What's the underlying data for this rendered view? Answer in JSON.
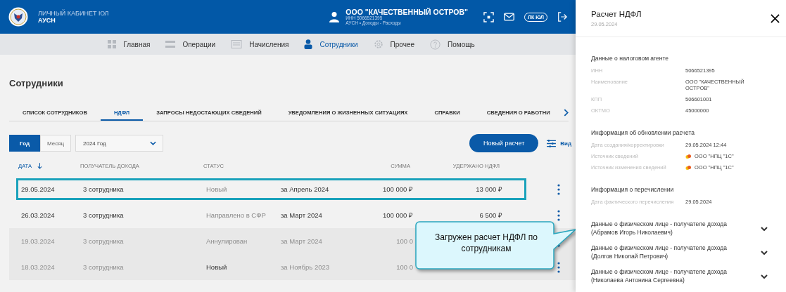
{
  "header": {
    "title": "ЛИЧНЫЙ КАБИНЕТ ЮЛ",
    "subtitle": "АУСН",
    "org": {
      "name": "ООО \"КАЧЕСТВЕННЫЙ ОСТРОВ\"",
      "inn": "ИНН 5066521395",
      "regime": "АУСН • Доходы - Расходы"
    },
    "lk_badge": "ЛК ЮЛ"
  },
  "nav": [
    {
      "label": "Главная",
      "selected": false
    },
    {
      "label": "Операции",
      "selected": false
    },
    {
      "label": "Начисления",
      "selected": false
    },
    {
      "label": "Сотрудники",
      "selected": true
    },
    {
      "label": "Прочее",
      "selected": false
    },
    {
      "label": "Помощь",
      "selected": false
    }
  ],
  "page_title": "Сотрудники",
  "tabs": [
    {
      "label": "СПИСОК СОТРУДНИКОВ",
      "selected": false
    },
    {
      "label": "НДФЛ",
      "selected": true
    },
    {
      "label": "ЗАПРОСЫ НЕДОСТАЮЩИХ СВЕДЕНИЙ",
      "selected": false
    },
    {
      "label": "УВЕДОМЛЕНИЯ О ЖИЗНЕННЫХ СИТУАЦИЯХ",
      "selected": false
    },
    {
      "label": "СПРАВКИ",
      "selected": false
    },
    {
      "label": "СВЕДЕНИЯ О РАБОТНИ",
      "selected": false
    }
  ],
  "period_toggle": [
    {
      "label": "Год",
      "selected": true
    },
    {
      "label": "Месяц",
      "selected": false
    }
  ],
  "year_select": {
    "value": "2024 Год"
  },
  "new_button": "Новый расчет",
  "view_button": "Вид",
  "table": {
    "columns": [
      {
        "label": "ДАТА",
        "sorted": true
      },
      {
        "label": "ПОЛУЧАТЕЛЬ ДОХОДА",
        "sorted": false
      },
      {
        "label": "СТАТУС",
        "sorted": false
      },
      {
        "label": "СУММА",
        "sorted": false
      },
      {
        "label": "УДЕРЖАНО НДФЛ",
        "sorted": false
      }
    ],
    "rows": [
      {
        "date": "29.05.2024",
        "recipient": "3 сотрудника",
        "status": "Новый",
        "period": "за Апрель 2024",
        "sum": "100 000 ₽",
        "withheld": "13 000 ₽",
        "highlighted": true,
        "dimmed": false,
        "status_strong": false
      },
      {
        "date": "26.03.2024",
        "recipient": "3 сотрудника",
        "status": "Направлено в СФР",
        "period": "за Март 2024",
        "sum": "100 000 ₽",
        "withheld": "6 500 ₽",
        "highlighted": false,
        "dimmed": false,
        "status_strong": false
      },
      {
        "date": "19.03.2024",
        "recipient": "3 сотрудника",
        "status": "Аннулирован",
        "period": "за Март 2024",
        "sum": "100 0",
        "highlighted": false,
        "dimmed": true,
        "status_strong": false
      },
      {
        "date": "18.03.2024",
        "recipient": "3 сотрудника",
        "status": "Новый",
        "period": "за Ноябрь 2023",
        "sum": "100 0",
        "highlighted": false,
        "dimmed": true,
        "status_strong": true
      }
    ]
  },
  "callout": "Загружен расчет НДФЛ по сотрудникам",
  "panel": {
    "title": "Расчет НДФЛ",
    "date": "29.05.2024",
    "sections": [
      {
        "heading": "Данные о налоговом агенте",
        "fields": [
          {
            "label": "ИНН",
            "value": "5066521395"
          },
          {
            "label": "Наименование",
            "value": "ООО \"КАЧЕСТВЕННЫЙ ОСТРОВ\""
          },
          {
            "label": "КПП",
            "value": "506601001"
          },
          {
            "label": "ОКТМО",
            "value": "45000000"
          }
        ]
      },
      {
        "heading": "Информация об обновлении расчета",
        "fields": [
          {
            "label": "Дата создания/корректировки",
            "value": "29.05.2024 12:44"
          },
          {
            "label": "Источник сведений",
            "value": "ООО \"НПЦ \"1С\"",
            "kind": "source"
          },
          {
            "label": "Источник изменения сведений",
            "value": "ООО \"НПЦ \"1С\"",
            "kind": "source"
          }
        ]
      },
      {
        "heading": "Информация о перечислении",
        "fields": [
          {
            "label": "Дата фактического перечисления",
            "value": "29.05.2024"
          }
        ]
      }
    ],
    "persons": [
      {
        "title": "Данные о физическом лице - получателе дохода",
        "name": "(Абрамов Игорь Николаевич)",
        "expanded": false
      },
      {
        "title": "Данные о физическом лице - получателе дохода",
        "name": "(Долгов Николай Петрович)",
        "expanded": false
      },
      {
        "title": "Данные о физическом лице - получателе дохода",
        "name": "(Николаева Антонина Сергеевна)",
        "expanded": false
      }
    ]
  }
}
